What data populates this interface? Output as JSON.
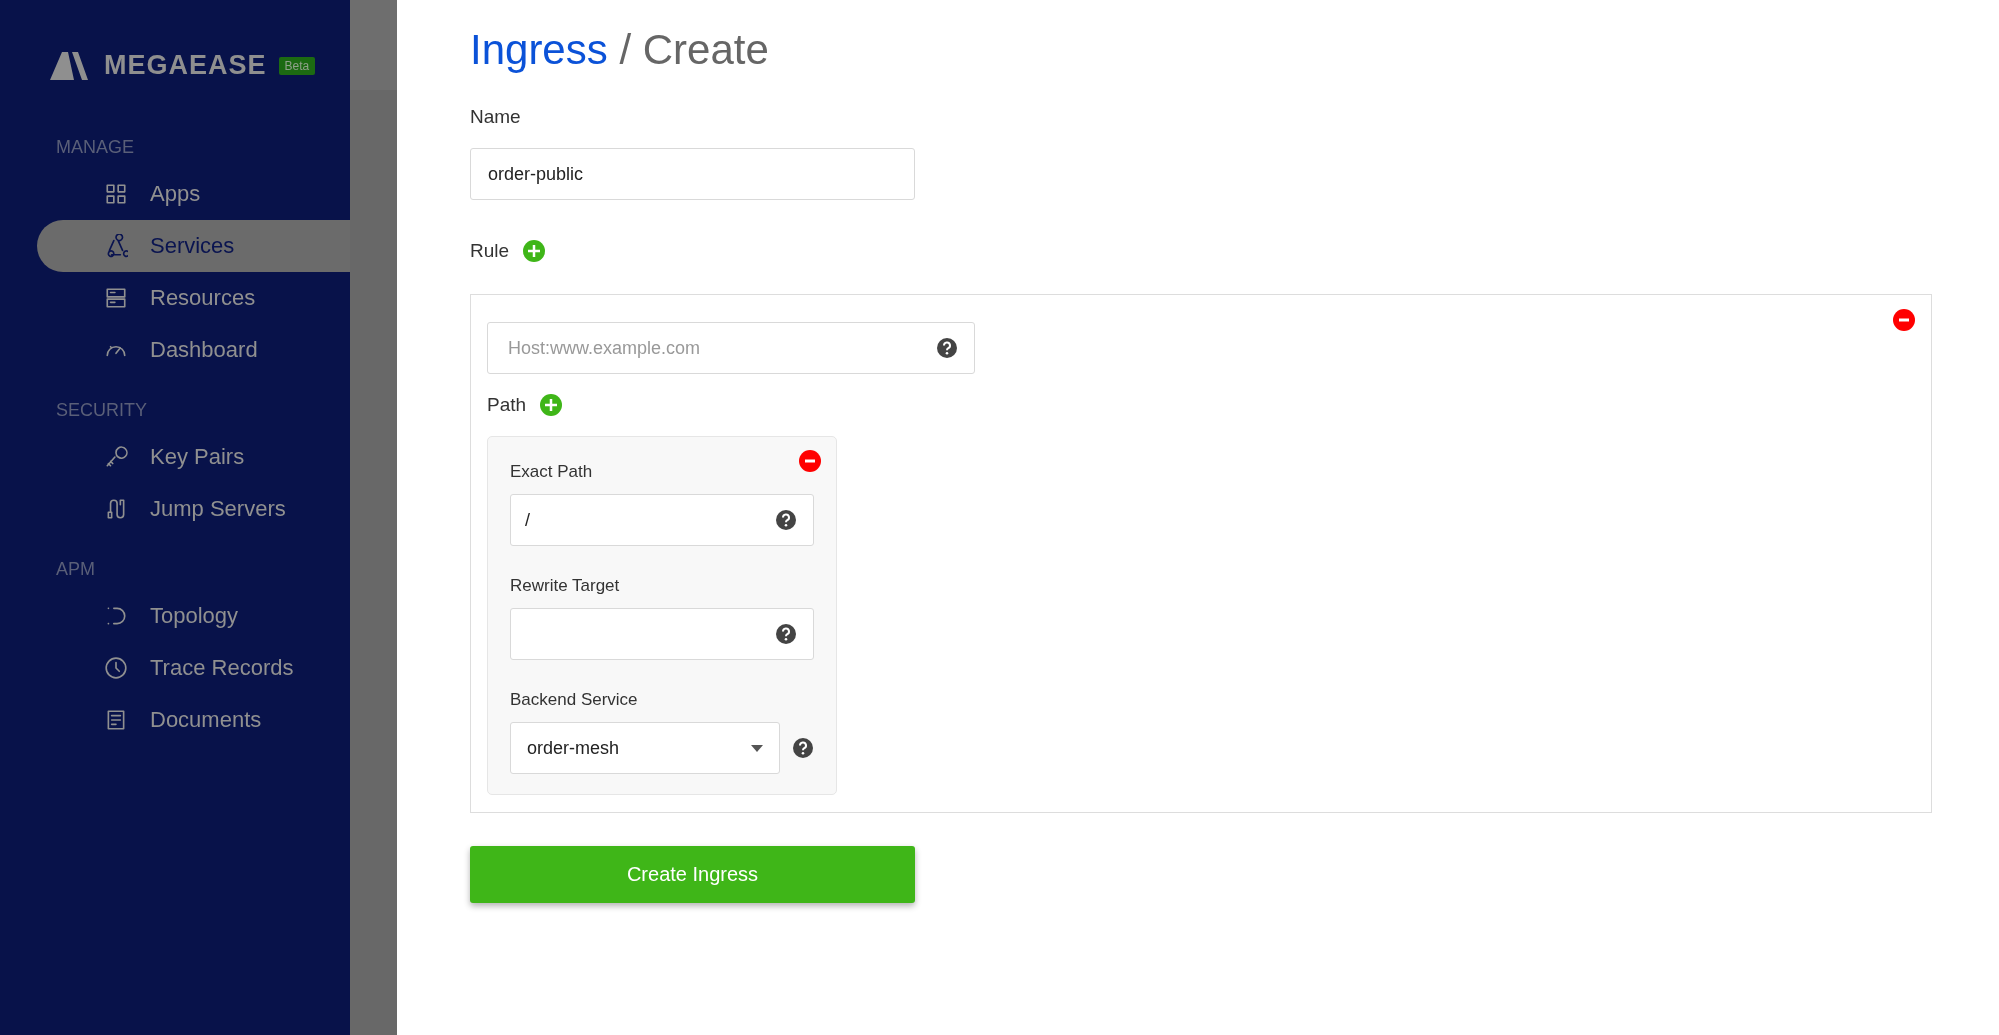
{
  "sidebar": {
    "logo": "MEGAEASE",
    "badge": "Beta",
    "sections": [
      {
        "title": "MANAGE",
        "items": [
          {
            "label": "Apps",
            "selected": false
          },
          {
            "label": "Services",
            "selected": true
          },
          {
            "label": "Resources",
            "selected": false
          },
          {
            "label": "Dashboard",
            "selected": false
          }
        ]
      },
      {
        "title": "SECURITY",
        "items": [
          {
            "label": "Key Pairs",
            "selected": false
          },
          {
            "label": "Jump Servers",
            "selected": false
          }
        ]
      },
      {
        "title": "APM",
        "items": [
          {
            "label": "Topology",
            "selected": false
          },
          {
            "label": "Trace Records",
            "selected": false
          },
          {
            "label": "Documents",
            "selected": false
          }
        ]
      }
    ]
  },
  "page": {
    "breadcrumb": "Ingress",
    "title": "/ Create"
  },
  "name_field": {
    "label": "Name",
    "value": "order-public"
  },
  "rule": {
    "label": "Rule",
    "host_field": {
      "placeholder": "Host:www.example.com"
    },
    "path_label": "Path",
    "path": {
      "exact_path": {
        "label": "Exact Path",
        "value": "/"
      },
      "rewrite_target": {
        "label": "Rewrite Target"
      },
      "backend_service": {
        "label": "Backend Service",
        "value": "order-mesh"
      }
    }
  },
  "submit_button": "Create Ingress"
}
